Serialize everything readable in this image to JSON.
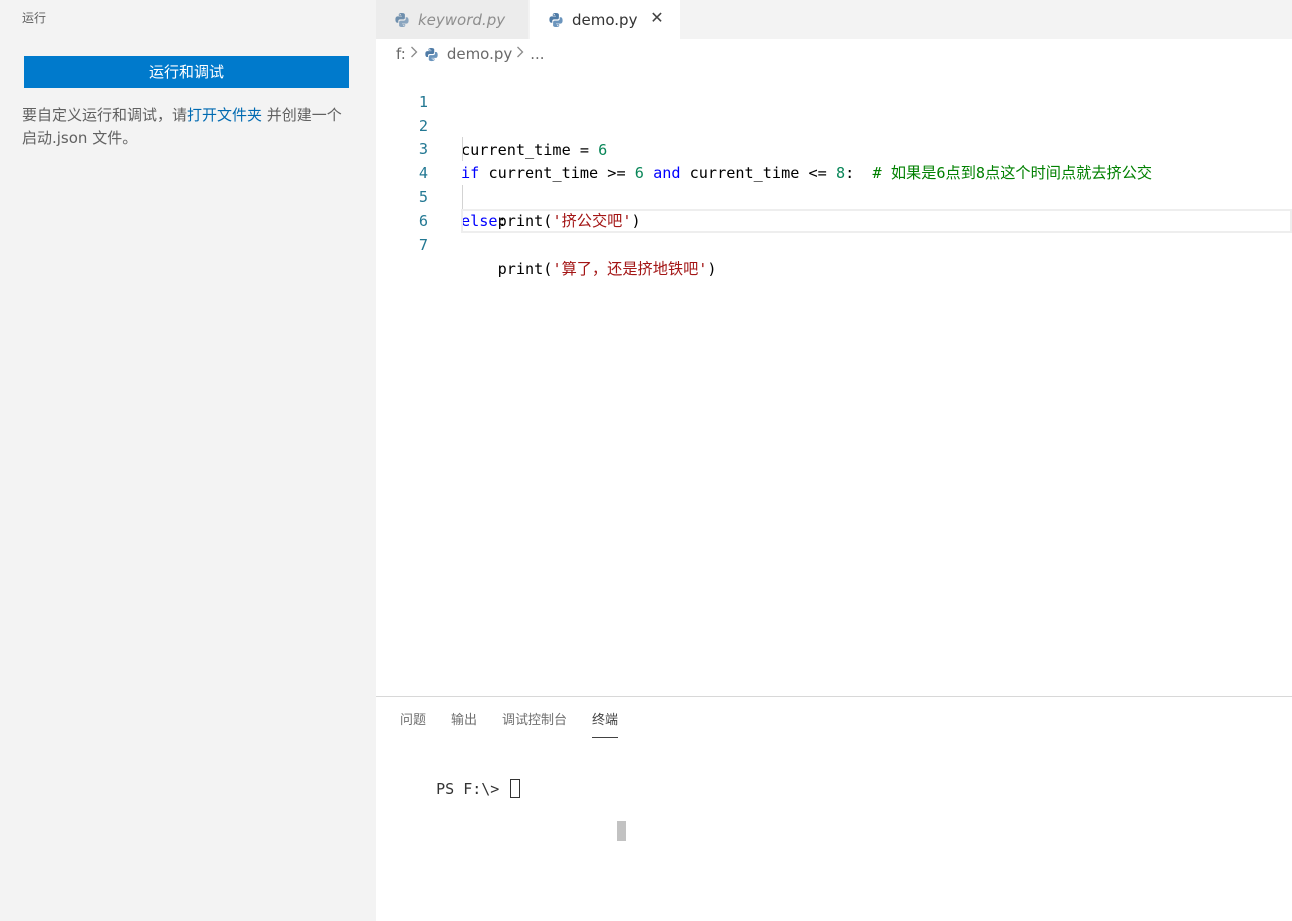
{
  "sidebar": {
    "title": "运行",
    "run_button": "运行和调试",
    "message_prefix": "要自定义运行和调试，请",
    "message_link": "打开文件夹",
    "message_suffix": " 并创建一个启动.json 文件。"
  },
  "tabs": [
    {
      "label": "keyword.py",
      "icon": "python-icon",
      "active": false
    },
    {
      "label": "demo.py",
      "icon": "python-icon",
      "active": true,
      "close": "✕"
    }
  ],
  "breadcrumb": {
    "drive": "f:",
    "file": "demo.py",
    "more": "..."
  },
  "editor": {
    "line_numbers": [
      "1",
      "2",
      "3",
      "4",
      "5",
      "6",
      "7"
    ],
    "lines": [
      [],
      [
        {
          "t": "current_time = ",
          "c": ""
        },
        {
          "t": "6",
          "c": "num"
        }
      ],
      [
        {
          "t": "if",
          "c": "kw"
        },
        {
          "t": " current_time >= ",
          "c": ""
        },
        {
          "t": "6",
          "c": "num"
        },
        {
          "t": " ",
          "c": ""
        },
        {
          "t": "and",
          "c": "kw"
        },
        {
          "t": " current_time <= ",
          "c": ""
        },
        {
          "t": "8",
          "c": "num"
        },
        {
          "t": ":  ",
          "c": ""
        },
        {
          "t": "# 如果是6点到8点这个时间点就去挤公交",
          "c": "cmt"
        }
      ],
      [
        {
          "t": "    print(",
          "c": ""
        },
        {
          "t": "'挤公交吧'",
          "c": "str"
        },
        {
          "t": ")",
          "c": ""
        }
      ],
      [
        {
          "t": "else",
          "c": "kw"
        },
        {
          "t": ":",
          "c": ""
        }
      ],
      [
        {
          "t": "    print(",
          "c": ""
        },
        {
          "t": "'算了，还是挤地铁吧'",
          "c": "str"
        },
        {
          "t": ")",
          "c": ""
        }
      ],
      []
    ]
  },
  "panel": {
    "tabs": [
      "问题",
      "输出",
      "调试控制台",
      "终端"
    ],
    "active_tab": "终端",
    "terminal_prompt": "PS F:\\>"
  },
  "colors": {
    "accent": "#007acc",
    "keyword": "#0000ff",
    "number": "#098658",
    "string": "#a31515",
    "comment": "#008000",
    "line_number": "#237893"
  }
}
